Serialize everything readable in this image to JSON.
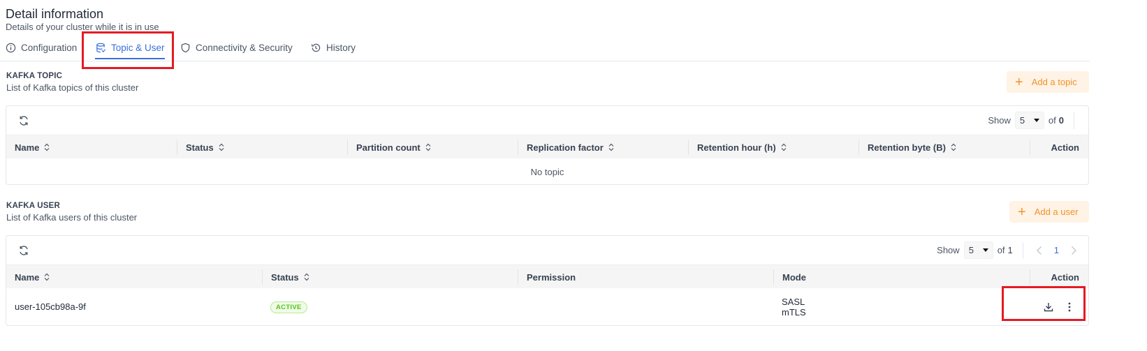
{
  "header": {
    "title": "Detail information",
    "subtitle": "Details of your cluster while it is in use"
  },
  "tabs": [
    {
      "label": "Configuration",
      "icon": "info-circle-icon",
      "active": false
    },
    {
      "label": "Topic & User",
      "icon": "database-icon",
      "active": true
    },
    {
      "label": "Connectivity & Security",
      "icon": "shield-icon",
      "active": false
    },
    {
      "label": "History",
      "icon": "history-icon",
      "active": false
    }
  ],
  "kafka_topic": {
    "title": "KAFKA TOPIC",
    "subtitle": "List of Kafka topics of this cluster",
    "add_label": "Add a topic",
    "show_label": "Show",
    "page_size": "5",
    "of_label": "of",
    "total": "0",
    "columns": [
      "Name",
      "Status",
      "Partition count",
      "Replication factor",
      "Retention hour (h)",
      "Retention byte (B)",
      "Action"
    ],
    "empty_text": "No topic"
  },
  "kafka_user": {
    "title": "KAFKA USER",
    "subtitle": "List of Kafka users of this cluster",
    "add_label": "Add a user",
    "show_label": "Show",
    "page_size": "5",
    "of_label": "of",
    "total": "1",
    "current_page": "1",
    "columns": [
      "Name",
      "Status",
      "Permission",
      "Mode",
      "Action"
    ],
    "rows": [
      {
        "name": "user-105cb98a-9f",
        "status": "ACTIVE",
        "permission": "",
        "mode": [
          "SASL",
          "mTLS"
        ]
      }
    ]
  },
  "colors": {
    "accent": "#3b6fd8",
    "orange": "#f0932b",
    "highlight": "#e31b23",
    "active_green": "#52c41a"
  }
}
